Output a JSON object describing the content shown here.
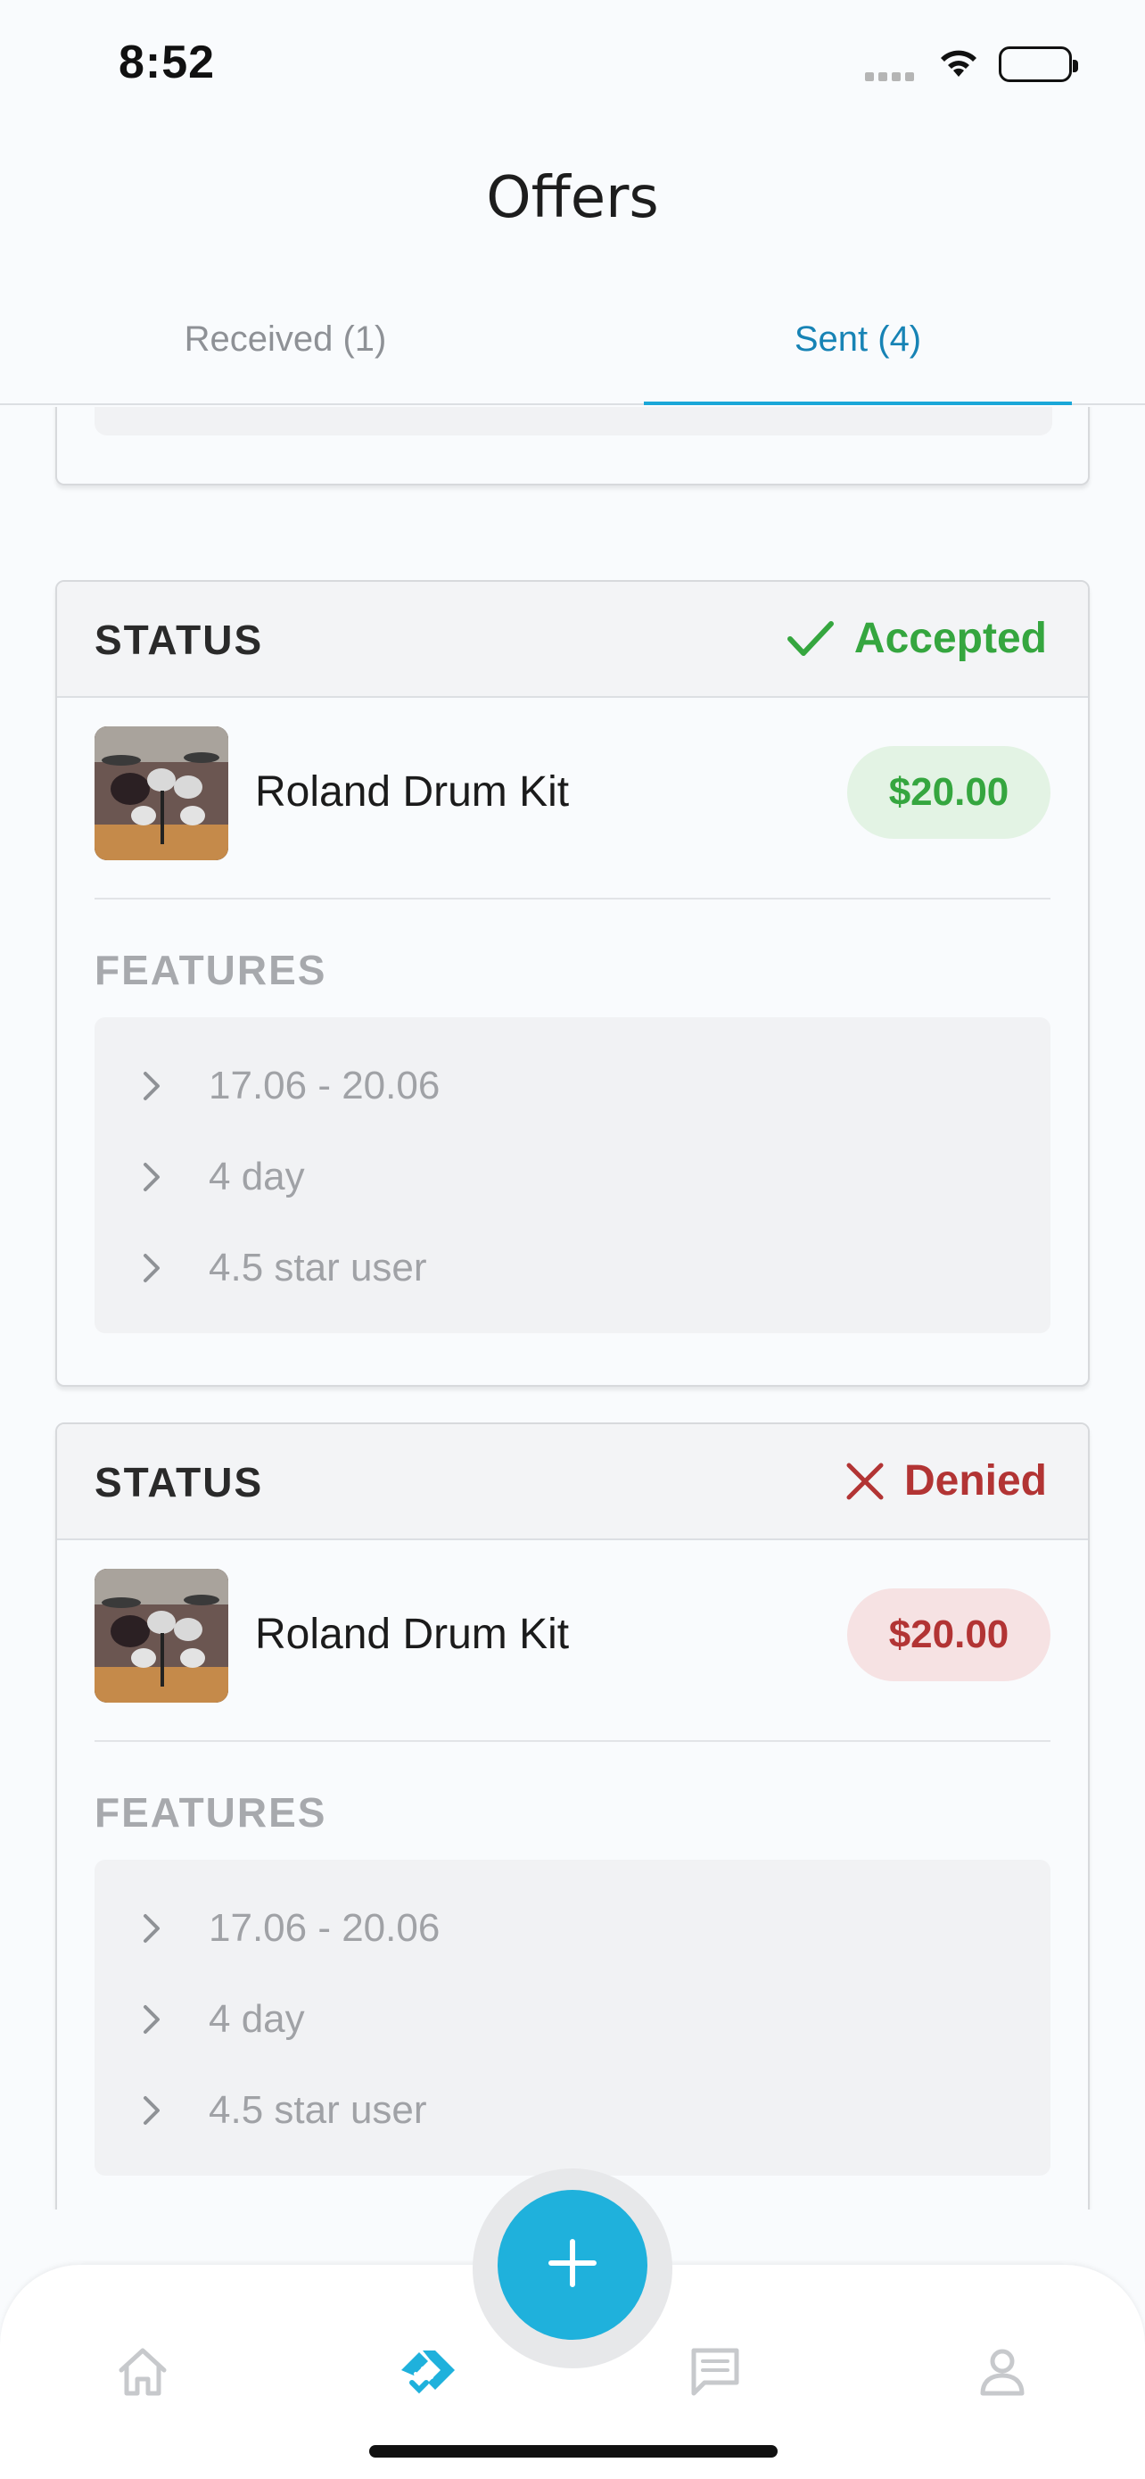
{
  "status_bar": {
    "time": "8:52"
  },
  "header": {
    "title": "Offers"
  },
  "tabs": [
    {
      "label": "Received (1)",
      "active": false
    },
    {
      "label": "Sent (4)",
      "active": true
    }
  ],
  "colors": {
    "accent": "#1aa7d8",
    "accepted": "#35a63f",
    "accepted_bg": "#e3f3e4",
    "denied": "#b23434",
    "denied_bg": "#f6e2e3"
  },
  "offers": [
    {
      "status_label": "STATUS",
      "status": "Accepted",
      "status_icon": "check-icon",
      "item_name": "Roland Drum Kit",
      "price": "$20.00",
      "features_title": "FEATURES",
      "features": [
        "17.06 - 20.06",
        "4 day",
        "4.5 star user"
      ]
    },
    {
      "status_label": "STATUS",
      "status": "Denied",
      "status_icon": "close-icon",
      "item_name": "Roland Drum Kit",
      "price": "$20.00",
      "features_title": "FEATURES",
      "features": [
        "17.06 - 20.06",
        "4 day",
        "4.5 star user"
      ]
    }
  ],
  "bottom_nav": {
    "items": [
      {
        "icon": "home-icon",
        "active": false
      },
      {
        "icon": "handshake-icon",
        "active": true
      },
      {
        "icon": "chat-icon",
        "active": false
      },
      {
        "icon": "profile-icon",
        "active": false
      }
    ],
    "fab_icon": "plus-icon"
  }
}
